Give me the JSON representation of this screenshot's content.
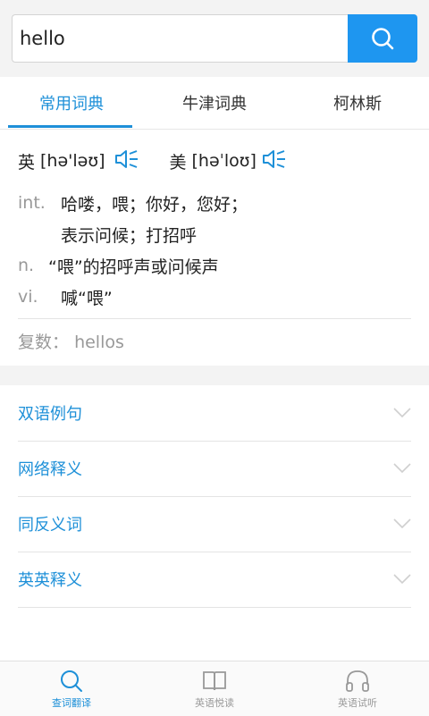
{
  "search": {
    "value": "hello"
  },
  "tabs": [
    {
      "label": "常用词典",
      "active": true
    },
    {
      "label": "牛津词典",
      "active": false
    },
    {
      "label": "柯林斯",
      "active": false
    }
  ],
  "phonetics": {
    "uk": {
      "label": "英",
      "ipa": "[hə'ləʊ]"
    },
    "us": {
      "label": "美",
      "ipa": "[həˈloʊ]"
    }
  },
  "definitions": [
    {
      "pos": "int.",
      "text": "哈喽，喂；你好，您好；"
    },
    {
      "pos": "",
      "text": "表示问候；打招呼"
    },
    {
      "pos": "n.",
      "text": "“喂”的招呼声或问候声"
    },
    {
      "pos": "vi.",
      "text": "喊“喂”"
    }
  ],
  "plural": {
    "label": "复数：",
    "value": "hellos"
  },
  "sections": [
    {
      "label": "双语例句"
    },
    {
      "label": "网络释义"
    },
    {
      "label": "同反义词"
    },
    {
      "label": "英英释义"
    }
  ],
  "bottom_nav": [
    {
      "label": "查词翻译",
      "icon": "search-icon",
      "active": true
    },
    {
      "label": "英语悦读",
      "icon": "book-icon",
      "active": false
    },
    {
      "label": "英语试听",
      "icon": "headphones-icon",
      "active": false
    }
  ],
  "colors": {
    "accent": "#1e90d8",
    "search_button": "#1e96f0",
    "muted": "#999999"
  }
}
